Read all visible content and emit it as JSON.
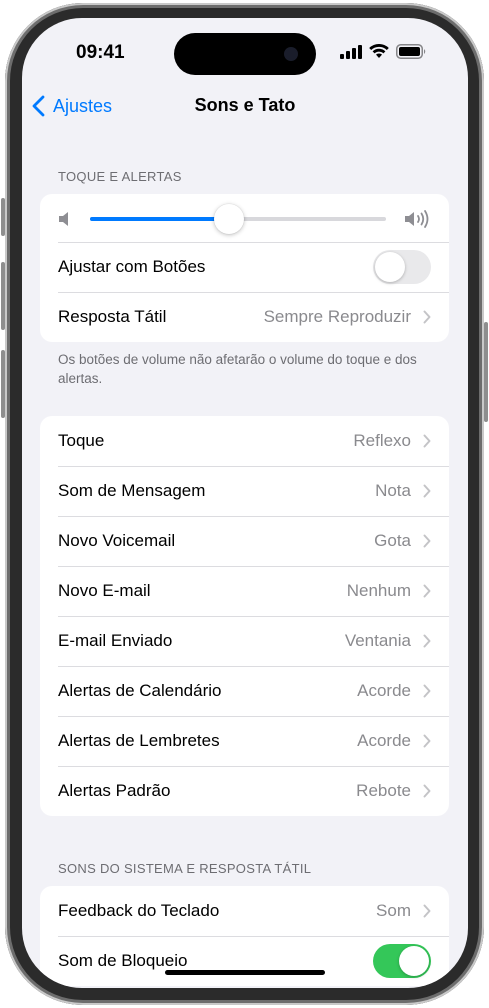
{
  "status": {
    "time": "09:41"
  },
  "nav": {
    "back_label": "Ajustes",
    "title": "Sons e Tato"
  },
  "section1": {
    "header": "TOQUE E ALERTAS",
    "volume_level": 0.47,
    "adjust_with_buttons": {
      "label": "Ajustar com Botões",
      "on": false
    },
    "haptic": {
      "label": "Resposta Tátil",
      "value": "Sempre Reproduzir"
    },
    "footer": "Os botões de volume não afetarão o volume do toque e dos alertas."
  },
  "sounds": [
    {
      "label": "Toque",
      "value": "Reflexo"
    },
    {
      "label": "Som de Mensagem",
      "value": "Nota"
    },
    {
      "label": "Novo Voicemail",
      "value": "Gota"
    },
    {
      "label": "Novo E-mail",
      "value": "Nenhum"
    },
    {
      "label": "E-mail Enviado",
      "value": "Ventania"
    },
    {
      "label": "Alertas de Calendário",
      "value": "Acorde"
    },
    {
      "label": "Alertas de Lembretes",
      "value": "Acorde"
    },
    {
      "label": "Alertas Padrão",
      "value": "Rebote"
    }
  ],
  "section3": {
    "header": "SONS DO SISTEMA E RESPOSTA TÁTIL",
    "keyboard_feedback": {
      "label": "Feedback do Teclado",
      "value": "Som"
    },
    "lock_sound": {
      "label": "Som de Bloqueio",
      "on": true
    }
  },
  "colors": {
    "accent": "#007aff",
    "toggle_on": "#34c759",
    "background": "#f2f2f7"
  }
}
